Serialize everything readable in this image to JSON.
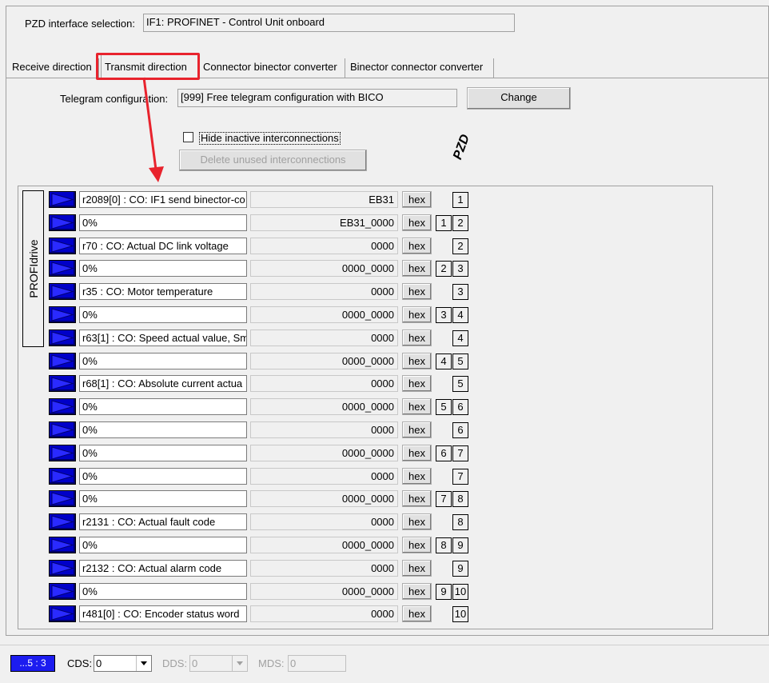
{
  "header": {
    "pzd_label": "PZD interface selection:",
    "pzd_value": "IF1:  PROFINET - Control Unit onboard"
  },
  "tabs": [
    {
      "label": "Receive direction"
    },
    {
      "label": "Transmit direction",
      "active": true
    },
    {
      "label": "Connector binector converter"
    },
    {
      "label": "Binector connector converter"
    }
  ],
  "telegram": {
    "label": "Telegram configuration:",
    "value": "[999] Free telegram configuration with BICO",
    "change_label": "Change"
  },
  "options": {
    "hide_inactive_label": "Hide inactive interconnections",
    "hide_inactive_checked": false,
    "delete_unused_label": "Delete unused interconnections"
  },
  "pzd_header": "PZD",
  "profidrive_label": "PROFIdrive",
  "hex_label": "hex",
  "rows": [
    {
      "source": "r2089[0] : CO: IF1 send binector-co",
      "value": "EB31",
      "pzd_a": "",
      "pzd_b": "1"
    },
    {
      "source": "0%",
      "value": "EB31_0000",
      "pzd_a": "1",
      "pzd_b": "2"
    },
    {
      "source": "r70 : CO: Actual DC link voltage",
      "value": "0000",
      "pzd_a": "",
      "pzd_b": "2"
    },
    {
      "source": "0%",
      "value": "0000_0000",
      "pzd_a": "2",
      "pzd_b": "3"
    },
    {
      "source": "r35 : CO: Motor temperature",
      "value": "0000",
      "pzd_a": "",
      "pzd_b": "3"
    },
    {
      "source": "0%",
      "value": "0000_0000",
      "pzd_a": "3",
      "pzd_b": "4"
    },
    {
      "source": "r63[1] : CO: Speed actual value, Sm",
      "value": "0000",
      "pzd_a": "",
      "pzd_b": "4"
    },
    {
      "source": "0%",
      "value": "0000_0000",
      "pzd_a": "4",
      "pzd_b": "5"
    },
    {
      "source": "r68[1] : CO: Absolute current actua",
      "value": "0000",
      "pzd_a": "",
      "pzd_b": "5"
    },
    {
      "source": "0%",
      "value": "0000_0000",
      "pzd_a": "5",
      "pzd_b": "6"
    },
    {
      "source": "0%",
      "value": "0000",
      "pzd_a": "",
      "pzd_b": "6"
    },
    {
      "source": "0%",
      "value": "0000_0000",
      "pzd_a": "6",
      "pzd_b": "7"
    },
    {
      "source": "0%",
      "value": "0000",
      "pzd_a": "",
      "pzd_b": "7"
    },
    {
      "source": "0%",
      "value": "0000_0000",
      "pzd_a": "7",
      "pzd_b": "8"
    },
    {
      "source": "r2131 : CO: Actual fault code",
      "value": "0000",
      "pzd_a": "",
      "pzd_b": "8"
    },
    {
      "source": "0%",
      "value": "0000_0000",
      "pzd_a": "8",
      "pzd_b": "9"
    },
    {
      "source": "r2132 : CO: Actual alarm code",
      "value": "0000",
      "pzd_a": "",
      "pzd_b": "9"
    },
    {
      "source": "0%",
      "value": "0000_0000",
      "pzd_a": "9",
      "pzd_b": "10"
    },
    {
      "source": "r481[0] : CO: Encoder status word",
      "value": "0000",
      "pzd_a": "",
      "pzd_b": "10"
    }
  ],
  "statusbar": {
    "indicator": "...5 : 3",
    "cds_label": "CDS:",
    "cds_value": "0",
    "dds_label": "DDS:",
    "dds_value": "0",
    "mds_label": "MDS:",
    "mds_value": "0"
  },
  "colors": {
    "accent_red": "#e8232d",
    "arrow_blue": "#0000c8",
    "status_blue": "#1c1cf0"
  }
}
